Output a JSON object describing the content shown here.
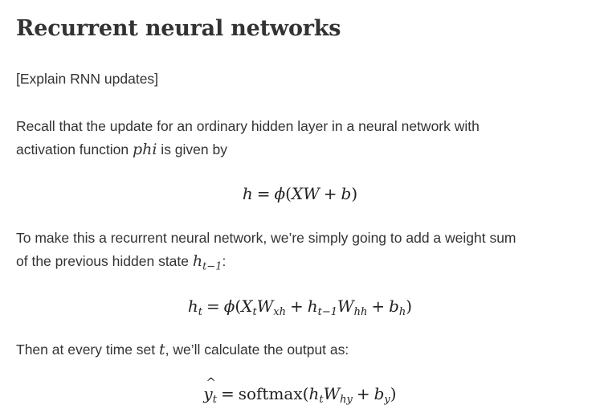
{
  "title": "Recurrent neural networks",
  "placeholder": "[Explain RNN updates]",
  "para1": {
    "line1": "Recall that the update for an ordinary hidden layer in a neural network with",
    "line2_before": "activation function ",
    "math_var": "phi",
    "line2_after": " is given by"
  },
  "eq1": {
    "lhs": "h",
    "eq": "=",
    "phi": "ϕ",
    "open": "(",
    "X": "X",
    "W": "W",
    "plus": "+",
    "b": "b",
    "close": ")"
  },
  "para2": {
    "line1": "To make this a recurrent neural network, we’re simply going to add a weight sum",
    "line2_before": "of the previous hidden state ",
    "math_h": "h",
    "math_sub": "t−1",
    "line2_after": ":"
  },
  "eq2": {
    "h": "h",
    "t": "t",
    "eq": "=",
    "phi": "ϕ",
    "open": "(",
    "X": "X",
    "W": "W",
    "xh": "xh",
    "plus1": "+",
    "tm1": "t−1",
    "hh": "hh",
    "plus2": "+",
    "b": "b",
    "bh": "h",
    "close": ")"
  },
  "para3": {
    "before": "Then at every time set ",
    "math_t": "t",
    "after": ", we’ll calculate the output as:"
  },
  "eq3": {
    "y": "y",
    "t": "t",
    "eq": "=",
    "softmax": "softmax",
    "open": "(",
    "h": "h",
    "W": "W",
    "hy": "hy",
    "plus": "+",
    "b": "b",
    "by": "y",
    "close": ")"
  }
}
